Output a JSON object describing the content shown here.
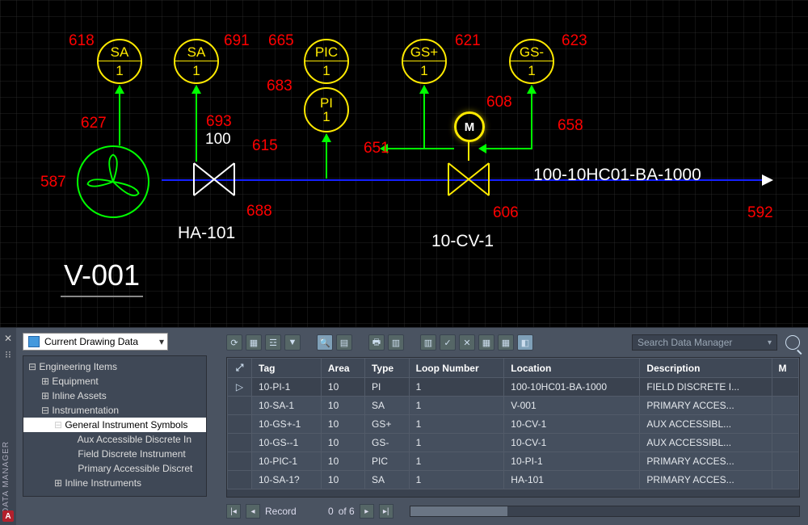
{
  "drawing": {
    "pipeline_label": "100-10HC01-BA-1000",
    "equipment_tag": "V-001",
    "manual_valve_tag": "HA-101",
    "control_valve_tag": "10-CV-1",
    "motor_label": "M",
    "extra_label_100": "100",
    "instruments": {
      "sa_left": {
        "func": "SA",
        "loop": "1"
      },
      "sa_right": {
        "func": "SA",
        "loop": "1"
      },
      "pic": {
        "func": "PIC",
        "loop": "1"
      },
      "pi": {
        "func": "PI",
        "loop": "1"
      },
      "gsp": {
        "func": "GS+",
        "loop": "1"
      },
      "gsm": {
        "func": "GS-",
        "loop": "1"
      }
    },
    "red_labels": {
      "n587": "587",
      "n618": "618",
      "n627": "627",
      "n691": "691",
      "n693": "693",
      "n688": "688",
      "n665": "665",
      "n683": "683",
      "n615": "615",
      "n651": "651",
      "n621": "621",
      "n608": "608",
      "n606": "606",
      "n623": "623",
      "n658": "658",
      "n592": "592"
    }
  },
  "panel": {
    "title": "DATA MANAGER",
    "dropdown": "Current Drawing Data",
    "search_placeholder": "Search Data Manager",
    "tree": [
      {
        "lvl": 1,
        "label": "Engineering Items",
        "exp": "⊟"
      },
      {
        "lvl": 2,
        "label": "Equipment",
        "exp": "⊞"
      },
      {
        "lvl": 2,
        "label": "Inline Assets",
        "exp": "⊞"
      },
      {
        "lvl": 2,
        "label": "Instrumentation",
        "exp": "⊟"
      },
      {
        "lvl": 3,
        "label": "General Instrument Symbols",
        "exp": "⊟",
        "selected": true
      },
      {
        "lvl": 4,
        "label": "Aux Accessible Discrete In",
        "exp": ""
      },
      {
        "lvl": 4,
        "label": "Field Discrete Instrument",
        "exp": ""
      },
      {
        "lvl": 4,
        "label": "Primary Accessible Discret",
        "exp": ""
      },
      {
        "lvl": 3,
        "label": "Inline Instruments",
        "exp": "⊞"
      }
    ],
    "columns": [
      "Tag",
      "Area",
      "Type",
      "Loop Number",
      "Location",
      "Description",
      "M"
    ],
    "rows": [
      {
        "sel": true,
        "tag": "10-PI-1",
        "area": "10",
        "type": "PI",
        "loop": "1",
        "location": "100-10HC01-BA-1000",
        "desc": "FIELD DISCRETE I..."
      },
      {
        "sel": false,
        "tag": "10-SA-1",
        "area": "10",
        "type": "SA",
        "loop": "1",
        "location": "V-001",
        "desc": "PRIMARY ACCES..."
      },
      {
        "sel": false,
        "tag": "10-GS+-1",
        "area": "10",
        "type": "GS+",
        "loop": "1",
        "location": "10-CV-1",
        "desc": "AUX ACCESSIBL..."
      },
      {
        "sel": false,
        "tag": "10-GS--1",
        "area": "10",
        "type": "GS-",
        "loop": "1",
        "location": "10-CV-1",
        "desc": "AUX ACCESSIBL..."
      },
      {
        "sel": false,
        "tag": "10-PIC-1",
        "area": "10",
        "type": "PIC",
        "loop": "1",
        "location": "10-PI-1",
        "desc": "PRIMARY ACCES..."
      },
      {
        "sel": false,
        "tag": "10-SA-1?",
        "area": "10",
        "type": "SA",
        "loop": "1",
        "location": "HA-101",
        "desc": "PRIMARY ACCES..."
      }
    ],
    "pager": {
      "label": "Record",
      "pos": "0",
      "of": "of 6"
    }
  }
}
